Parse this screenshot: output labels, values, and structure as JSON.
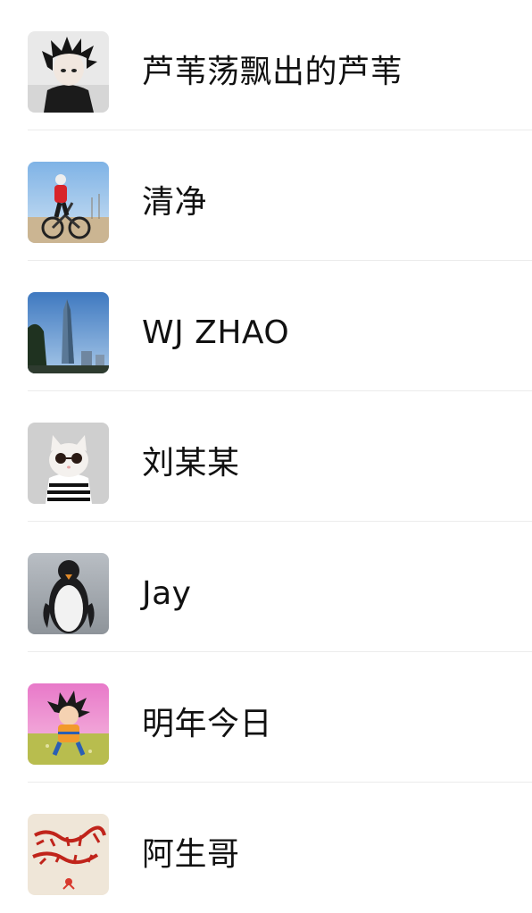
{
  "contacts": [
    {
      "name": "芦苇荡飘出的芦苇",
      "avatar": "avatar-dark-anime-boy"
    },
    {
      "name": "清净",
      "avatar": "avatar-cyclist-bmx"
    },
    {
      "name": "WJ ZHAO",
      "avatar": "avatar-skyscraper"
    },
    {
      "name": "刘某某",
      "avatar": "avatar-cat-sunglasses"
    },
    {
      "name": "Jay",
      "avatar": "avatar-penguin"
    },
    {
      "name": "明年今日",
      "avatar": "avatar-cartoon-goku"
    },
    {
      "name": "阿生哥",
      "avatar": "avatar-red-calligraphy"
    }
  ],
  "colors": {
    "background": "#ffffff",
    "text": "#111111",
    "divider": "#ececec"
  }
}
